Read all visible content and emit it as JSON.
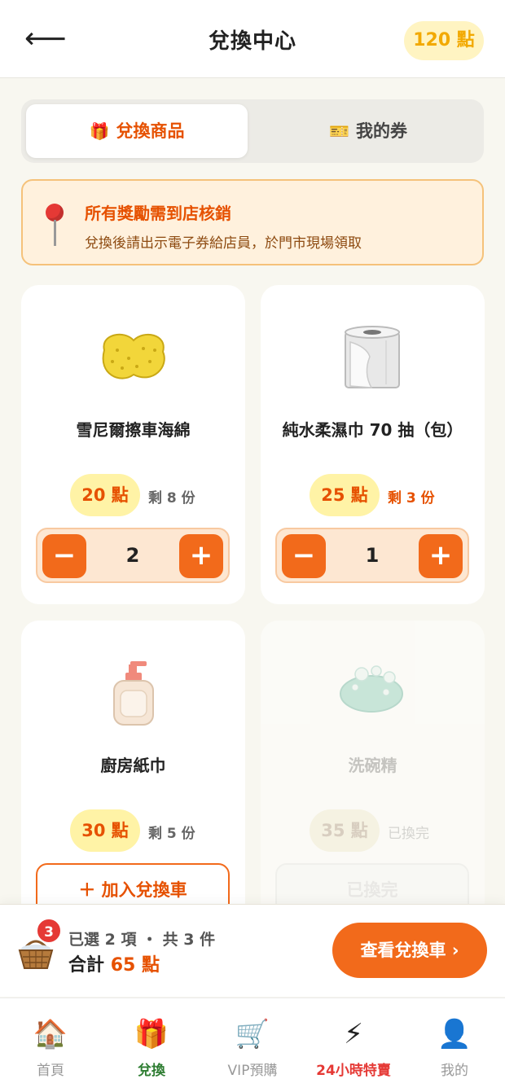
{
  "header": {
    "title": "兌換中心",
    "points": "120 點"
  },
  "tabs": [
    {
      "icon": "gift-icon",
      "label": "兌換商品",
      "active": true
    },
    {
      "icon": "ticket-icon",
      "label": "我的券",
      "active": false
    }
  ],
  "notice": {
    "icon": "pin-icon",
    "title": "所有獎勵需到店核銷",
    "subtitle": "兌換後請出示電子券給店員，於門市現場領取"
  },
  "products": [
    {
      "name": "雪尼爾擦車海綿",
      "icon": "sponge-icon",
      "points": "20 點",
      "stock": "剩 8 份",
      "quantity": "2"
    },
    {
      "name": "純水柔濕巾 70 抽（包）",
      "icon": "toilet-roll-icon",
      "points": "25 點",
      "stock": "剩 3 份",
      "quantity": "1"
    },
    {
      "name": "廚房紙巾",
      "icon": "soap-bottle-icon",
      "points": "30 點",
      "stock": "剩 5 份",
      "action": "＋ 加入兌換車"
    },
    {
      "name": "洗碗精",
      "icon": "soap-bar-icon",
      "points": "35 點",
      "stock": "已換完",
      "action": "已換完"
    }
  ],
  "cart": {
    "badge": "3",
    "summary": "已選 2 項 ・ 共 3 件",
    "total_label": "合計",
    "total_value": "65 點",
    "button": "查看兌換車 ›"
  },
  "nav": [
    {
      "icon": "house-icon",
      "label": "首頁"
    },
    {
      "icon": "gift-icon",
      "label": "兌換",
      "active": true
    },
    {
      "icon": "cart-icon",
      "label": "VIP預購"
    },
    {
      "icon": "lightning-icon",
      "label": "24小時特賣"
    },
    {
      "icon": "user-icon",
      "label": "我的"
    }
  ],
  "colors": {
    "accent": "#f26a1b",
    "accent_text": "#e65100",
    "nav_active": "#2e7d32",
    "points_badge": "#fff4c2"
  }
}
